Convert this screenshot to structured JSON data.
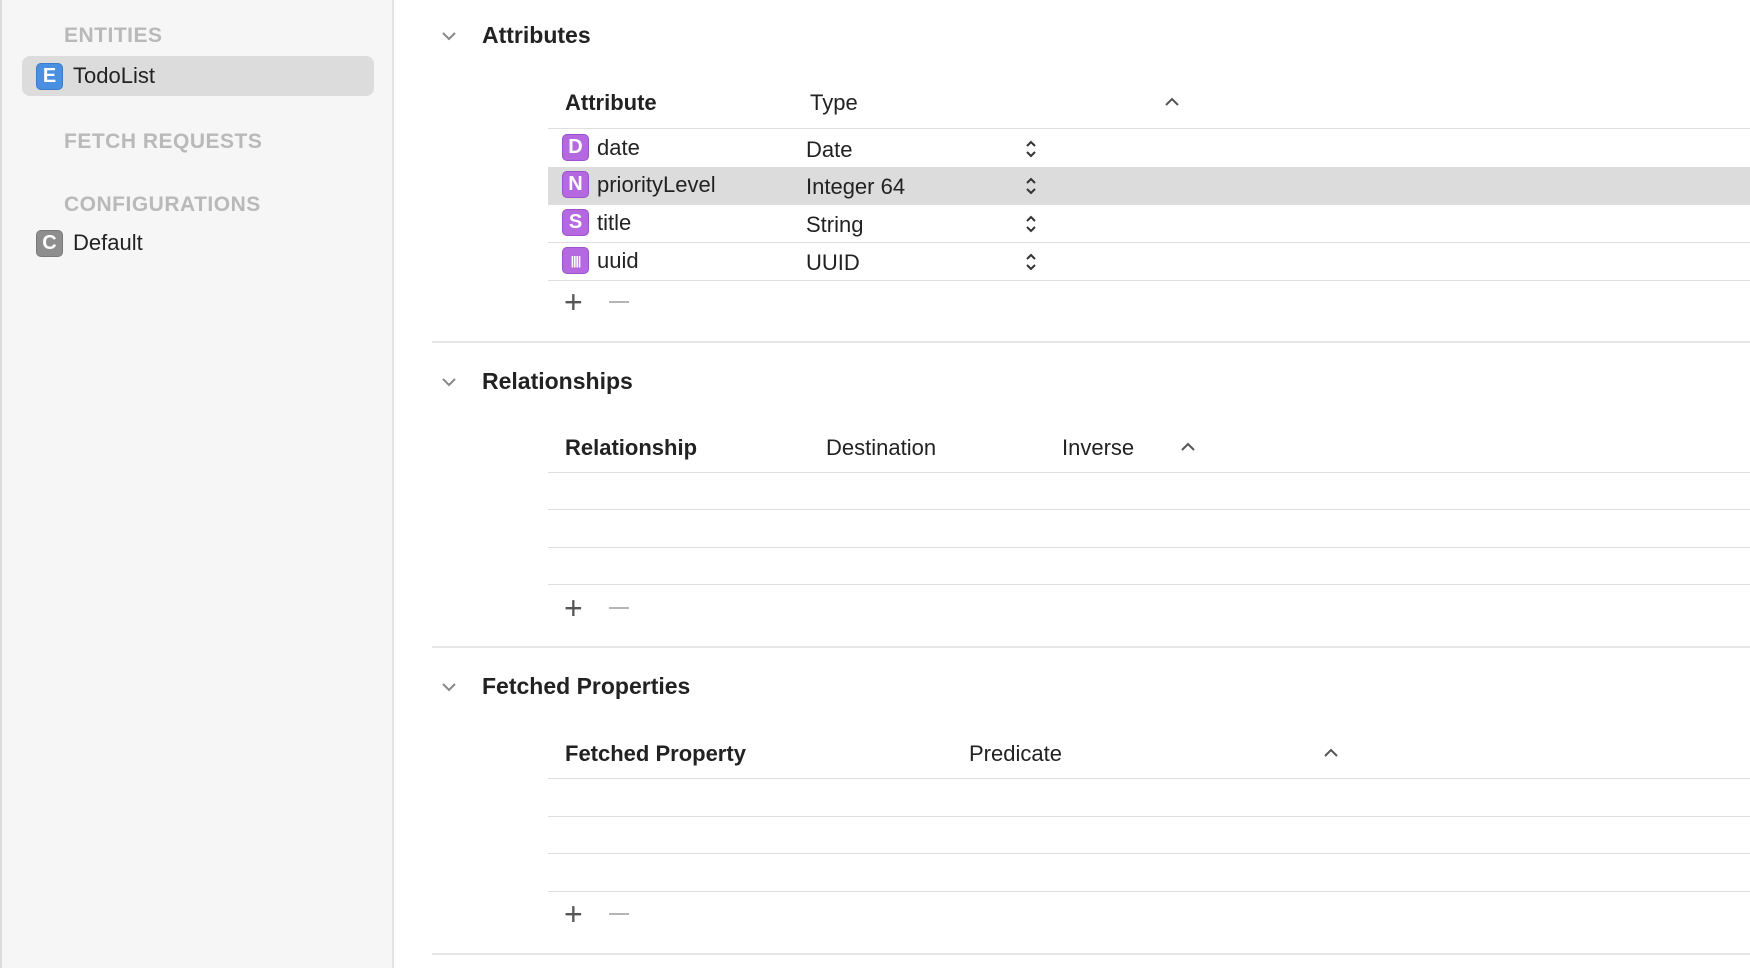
{
  "sidebar": {
    "entities_header": "ENTITIES",
    "entities": [
      {
        "badge": "E",
        "label": "TodoList"
      }
    ],
    "fetch_requests_header": "FETCH REQUESTS",
    "configurations_header": "CONFIGURATIONS",
    "configurations": [
      {
        "badge": "C",
        "label": "Default"
      }
    ]
  },
  "attributes": {
    "title": "Attributes",
    "col_attribute": "Attribute",
    "col_type": "Type",
    "rows": [
      {
        "badge": "D",
        "name": "date",
        "type": "Date"
      },
      {
        "badge": "N",
        "name": "priorityLevel",
        "type": "Integer 64"
      },
      {
        "badge": "S",
        "name": "title",
        "type": "String"
      },
      {
        "badge": "||||",
        "name": "uuid",
        "type": "UUID"
      }
    ],
    "add": "+",
    "remove": "—"
  },
  "relationships": {
    "title": "Relationships",
    "col_relationship": "Relationship",
    "col_destination": "Destination",
    "col_inverse": "Inverse"
  },
  "fetched_properties": {
    "title": "Fetched Properties",
    "col_fetched_property": "Fetched Property",
    "col_predicate": "Predicate"
  },
  "colors": {
    "selection": "#dcdcdc",
    "entity_badge": "#4a90e2",
    "attribute_badge": "#b569e0",
    "config_badge": "#8e8e8e"
  }
}
